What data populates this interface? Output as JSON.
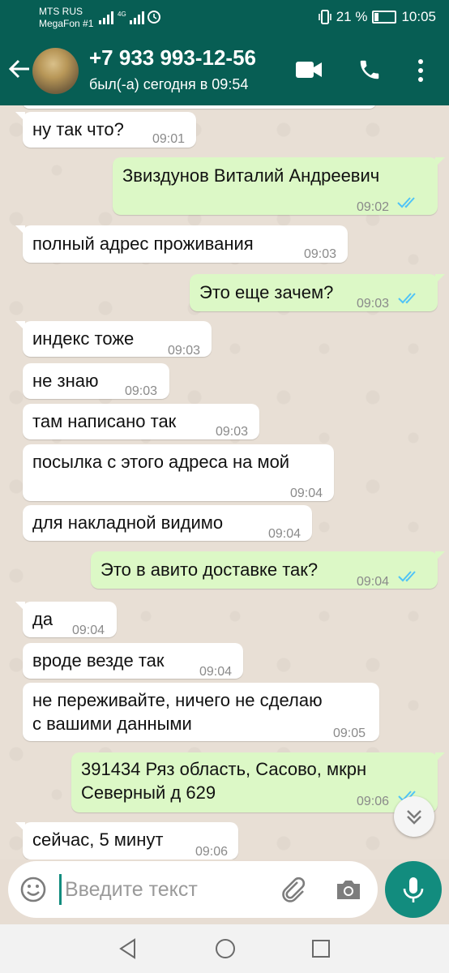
{
  "status_bar": {
    "carrier_1": "MTS RUS",
    "carrier_2": "MegaFon #1",
    "battery": "21 %",
    "time": "10:05"
  },
  "header": {
    "contact_name": "+7 933 993-12-56",
    "last_seen": "был(-а) сегодня в 09:54",
    "icons": [
      "back-arrow-icon",
      "video-call-icon",
      "phone-icon",
      "more-vert-icon"
    ]
  },
  "messages": [
    {
      "dir": "in",
      "text": "ну так что?",
      "time": "09:01"
    },
    {
      "dir": "out",
      "text": "Звиздунов Виталий Андреевич",
      "time": "09:02",
      "read": true
    },
    {
      "dir": "in",
      "text": "полный адрес проживания",
      "time": "09:03"
    },
    {
      "dir": "out",
      "text": "Это еще зачем?",
      "time": "09:03",
      "read": true
    },
    {
      "dir": "in",
      "text": "индекс тоже",
      "time": "09:03"
    },
    {
      "dir": "in",
      "text": "не знаю",
      "time": "09:03"
    },
    {
      "dir": "in",
      "text": "там написано так",
      "time": "09:03"
    },
    {
      "dir": "in",
      "text": "посылка с этого адреса на мой",
      "time": "09:04"
    },
    {
      "dir": "in",
      "text": "для накладной видимо",
      "time": "09:04"
    },
    {
      "dir": "out",
      "text": "Это в авито доставке так?",
      "time": "09:04",
      "read": true
    },
    {
      "dir": "in",
      "text": "да",
      "time": "09:04"
    },
    {
      "dir": "in",
      "text": "вроде везде так",
      "time": "09:04"
    },
    {
      "dir": "in",
      "lines": [
        "не переживайте, ничего не сделаю",
        "с вашими данными"
      ],
      "time": "09:05"
    },
    {
      "dir": "out",
      "lines": [
        "391434 Ряз область, Сасово, мкрн",
        "Северный д 629"
      ],
      "time": "09:06",
      "read": true
    },
    {
      "dir": "in",
      "text": "сейчас, 5 минут",
      "time": "09:06"
    }
  ],
  "composer": {
    "placeholder": "Введите текст",
    "icons": [
      "emoji-icon",
      "attach-icon",
      "camera-icon",
      "mic-icon"
    ]
  },
  "colors": {
    "header": "#075e54",
    "accent": "#128c7e",
    "outgoing_bubble": "#dcf8c6",
    "incoming_bubble": "#ffffff",
    "read_ticks": "#4fc3f7"
  }
}
